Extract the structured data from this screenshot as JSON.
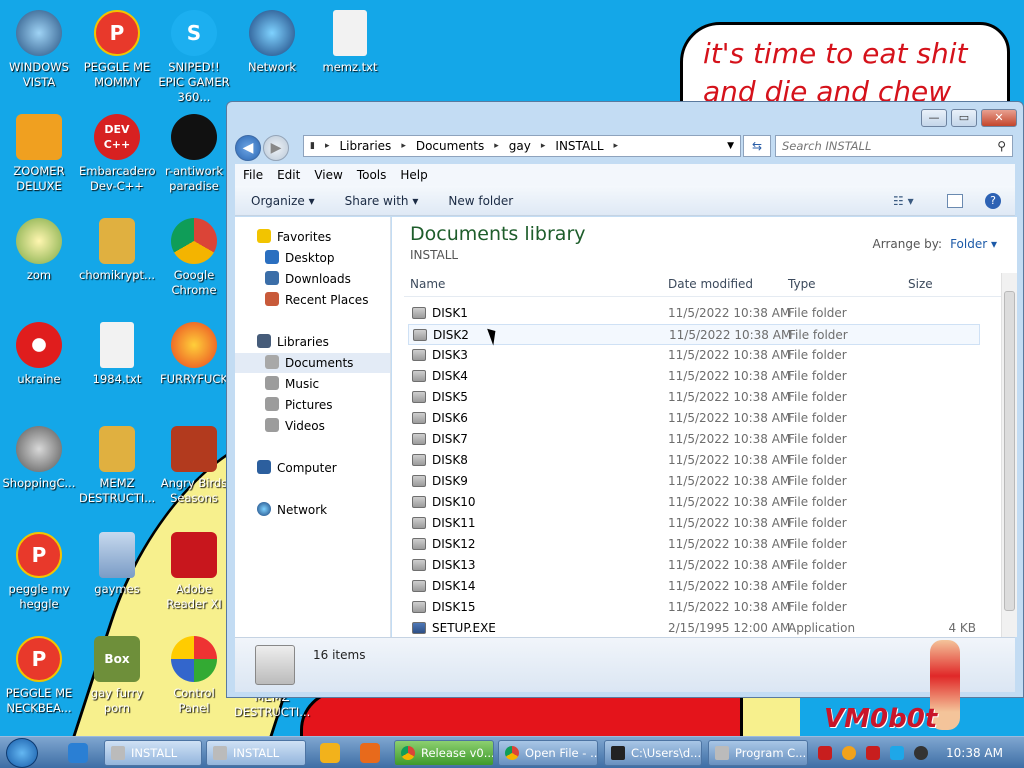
{
  "speech_bubble": {
    "line1": "it's time to eat shit",
    "line2": "and die and chew"
  },
  "desktop_icons": [
    {
      "label": "WINDOWS VISTA"
    },
    {
      "label": "PEGGLE ME MOMMY"
    },
    {
      "label": "SNIPED!! EPIC GAMER 360..."
    },
    {
      "label": "Network"
    },
    {
      "label": "memz.txt"
    },
    {
      "label": "ZOOMER DELUXE"
    },
    {
      "label": "Embarcadero Dev-C++"
    },
    {
      "label": "r-antiwork paradise"
    },
    {
      "label": "zom"
    },
    {
      "label": "chomikrypt..."
    },
    {
      "label": "Google Chrome"
    },
    {
      "label": "ukraine"
    },
    {
      "label": "1984.txt"
    },
    {
      "label": "FURRYFUCK"
    },
    {
      "label": "ShoppingC..."
    },
    {
      "label": "MEMZ DESTRUCTI..."
    },
    {
      "label": "Angry Birds Seasons"
    },
    {
      "label": "peggle my heggle"
    },
    {
      "label": "gaymes"
    },
    {
      "label": "Adobe Reader XI"
    },
    {
      "label": "PEGGLE ME NECKBEA..."
    },
    {
      "label": "gay furry porn"
    },
    {
      "label": "Control Panel"
    },
    {
      "label": "MEMZ DESTRUCTI..."
    }
  ],
  "icon_glyphs": {
    "dev": "DEV C++",
    "box": "Box",
    "peggle": "P",
    "skype": "S"
  },
  "window": {
    "buttons": {
      "minimize": "—",
      "maximize": "▭",
      "close": "✕"
    },
    "breadcrumbs": [
      "Libraries",
      "Documents",
      "gay",
      "INSTALL"
    ],
    "search_placeholder": "Search INSTALL",
    "menu": [
      "File",
      "Edit",
      "View",
      "Tools",
      "Help"
    ],
    "commands": {
      "organize": "Organize ▾",
      "share": "Share with ▾",
      "new_folder": "New folder"
    },
    "nav": {
      "favorites": "Favorites",
      "desktop": "Desktop",
      "downloads": "Downloads",
      "recent": "Recent Places",
      "libraries": "Libraries",
      "documents": "Documents",
      "music": "Music",
      "pictures": "Pictures",
      "videos": "Videos",
      "computer": "Computer",
      "network": "Network"
    },
    "library_title": "Documents library",
    "library_sub": "INSTALL",
    "arrange_label": "Arrange by:",
    "arrange_value": "Folder ▾",
    "columns": {
      "name": "Name",
      "date": "Date modified",
      "type": "Type",
      "size": "Size"
    },
    "files": [
      {
        "name": "DISK1",
        "date": "11/5/2022 10:38 AM",
        "type": "File folder",
        "size": ""
      },
      {
        "name": "DISK2",
        "date": "11/5/2022 10:38 AM",
        "type": "File folder",
        "size": ""
      },
      {
        "name": "DISK3",
        "date": "11/5/2022 10:38 AM",
        "type": "File folder",
        "size": ""
      },
      {
        "name": "DISK4",
        "date": "11/5/2022 10:38 AM",
        "type": "File folder",
        "size": ""
      },
      {
        "name": "DISK5",
        "date": "11/5/2022 10:38 AM",
        "type": "File folder",
        "size": ""
      },
      {
        "name": "DISK6",
        "date": "11/5/2022 10:38 AM",
        "type": "File folder",
        "size": ""
      },
      {
        "name": "DISK7",
        "date": "11/5/2022 10:38 AM",
        "type": "File folder",
        "size": ""
      },
      {
        "name": "DISK8",
        "date": "11/5/2022 10:38 AM",
        "type": "File folder",
        "size": ""
      },
      {
        "name": "DISK9",
        "date": "11/5/2022 10:38 AM",
        "type": "File folder",
        "size": ""
      },
      {
        "name": "DISK10",
        "date": "11/5/2022 10:38 AM",
        "type": "File folder",
        "size": ""
      },
      {
        "name": "DISK11",
        "date": "11/5/2022 10:38 AM",
        "type": "File folder",
        "size": ""
      },
      {
        "name": "DISK12",
        "date": "11/5/2022 10:38 AM",
        "type": "File folder",
        "size": ""
      },
      {
        "name": "DISK13",
        "date": "11/5/2022 10:38 AM",
        "type": "File folder",
        "size": ""
      },
      {
        "name": "DISK14",
        "date": "11/5/2022 10:38 AM",
        "type": "File folder",
        "size": ""
      },
      {
        "name": "DISK15",
        "date": "11/5/2022 10:38 AM",
        "type": "File folder",
        "size": ""
      },
      {
        "name": "SETUP.EXE",
        "date": "2/15/1995 12:00 AM",
        "type": "Application",
        "size": "4 KB"
      }
    ],
    "item_count": "16 items"
  },
  "taskbar": {
    "buttons": [
      "INSTALL",
      "INSTALL",
      "Release v0....",
      "Open File - ...",
      "C:\\Users\\d...",
      "Program C..."
    ],
    "clock": "10:38 AM"
  },
  "watermark": "VM0b0t",
  "colors": {
    "desktop": "#14a7e8",
    "library_title": "#1e5d2b",
    "speech_text": "#d5121b"
  }
}
